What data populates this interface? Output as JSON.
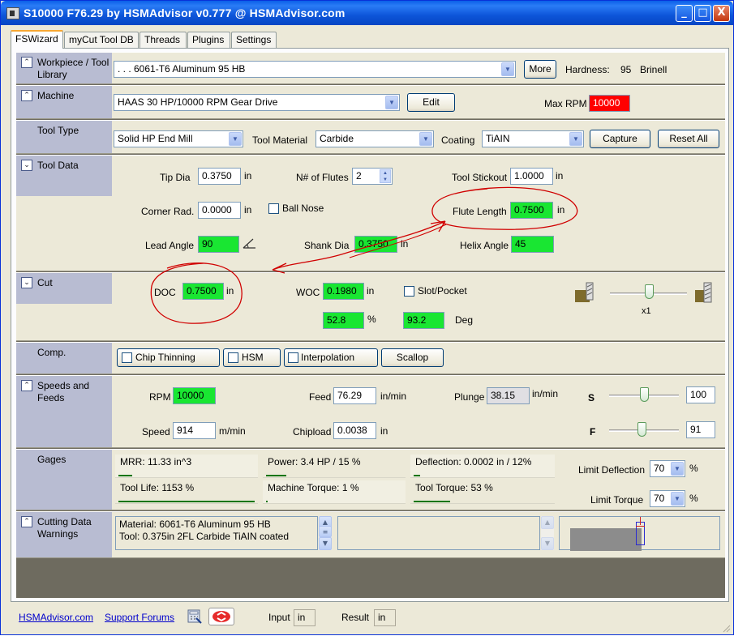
{
  "window": {
    "title": "S10000 F76.29 by HSMAdvisor v0.777 @ HSMAdvisor.com",
    "minimize": "_",
    "maximize": "□",
    "close": "X"
  },
  "tabs": [
    "FSWizard",
    "myCut Tool DB",
    "Threads",
    "Plugins",
    "Settings"
  ],
  "workpiece": {
    "label": "Workpiece / Tool Library",
    "material": ". . . 6061-T6 Aluminum 95 HB",
    "more_button": "More",
    "hardness_label": "Hardness:",
    "hardness_value": "95",
    "hardness_unit": "Brinell"
  },
  "machine": {
    "label": "Machine",
    "value": "HAAS 30 HP/10000 RPM Gear Drive",
    "edit_button": "Edit",
    "max_rpm_label": "Max RPM",
    "max_rpm": "10000"
  },
  "tool_type": {
    "label": "Tool Type",
    "type": "Solid HP End Mill",
    "material_label": "Tool Material",
    "material": "Carbide",
    "coating_label": "Coating",
    "coating": "TiAIN",
    "capture_button": "Capture",
    "reset_button": "Reset All"
  },
  "tool_data": {
    "label": "Tool Data",
    "tip_dia_label": "Tip Dia",
    "tip_dia": "0.3750",
    "tip_dia_unit": "in",
    "flutes_label": "N# of Flutes",
    "flutes": "2",
    "stickout_label": "Tool Stickout",
    "stickout": "1.0000",
    "stickout_unit": "in",
    "corner_label": "Corner Rad.",
    "corner": "0.0000",
    "corner_unit": "in",
    "ball_nose_label": "Ball Nose",
    "flute_len_label": "Flute Length",
    "flute_len": "0.7500",
    "flute_len_unit": "in",
    "lead_label": "Lead Angle",
    "lead": "90",
    "shank_label": "Shank Dia",
    "shank": "0.3750",
    "shank_unit": "in",
    "helix_label": "Helix Angle",
    "helix": "45"
  },
  "cut": {
    "label": "Cut",
    "doc_label": "DOC",
    "doc": "0.7500",
    "doc_unit": "in",
    "woc_label": "WOC",
    "woc": "0.1980",
    "woc_unit": "in",
    "slot_label": "Slot/Pocket",
    "woc_pct": "52.8",
    "pct_unit": "%",
    "angle": "93.2",
    "angle_unit": "Deg",
    "slider_label": "x1",
    "slider_level": 0.5
  },
  "comp": {
    "label": "Comp.",
    "chip_thinning": "Chip Thinning",
    "hsm": "HSM",
    "interpolation": "Interpolation",
    "scallop": "Scallop"
  },
  "speeds": {
    "label": "Speeds and Feeds",
    "rpm_label": "RPM",
    "rpm": "10000",
    "feed_label": "Feed",
    "feed": "76.29",
    "feed_unit": "in/min",
    "plunge_label": "Plunge",
    "plunge": "38.15",
    "plunge_unit": "in/min",
    "s_label": "S",
    "s_value": "100",
    "s_level": 0.5,
    "speed_label": "Speed",
    "speed": "914",
    "speed_unit": "m/min",
    "chipload_label": "Chipload",
    "chipload": "0.0038",
    "chipload_unit": "in",
    "f_label": "F",
    "f_value": "91",
    "f_level": 0.46
  },
  "gages": {
    "label": "Gages",
    "mrr": "MRR: 11.33 in^3",
    "mrr_level": 0.1,
    "power": "Power: 3.4 HP / 15 %",
    "power_level": 0.15,
    "deflection": "Deflection: 0.0002 in / 12%",
    "deflection_level": 0.05,
    "tool_life": "Tool Life: 1153 %",
    "tool_life_level": 1.0,
    "machine_torque": "Machine Torque: 1 %",
    "machine_torque_level": 0.01,
    "tool_torque": "Tool Torque: 53 %",
    "tool_torque_level": 0.27,
    "limit_deflection_label": "Limit Deflection",
    "limit_deflection": "70",
    "limit_torque_label": "Limit Torque",
    "limit_torque": "70",
    "pct": "%"
  },
  "warnings": {
    "label": "Cutting Data Warnings",
    "line1": "Material: 6061-T6 Aluminum 95 HB",
    "line2": "Tool: 0.375in 2FL Carbide TiAIN coated"
  },
  "footer": {
    "site_link": "HSMAdvisor.com",
    "forum_link": "Support Forums",
    "input_label": "Input",
    "input_unit": "in",
    "result_label": "Result",
    "result_unit": "in"
  },
  "colors": {
    "green": "#19e632",
    "red": "#ff0000",
    "title_blue": "#0a5fe8",
    "annotation_red": "#d00000"
  }
}
